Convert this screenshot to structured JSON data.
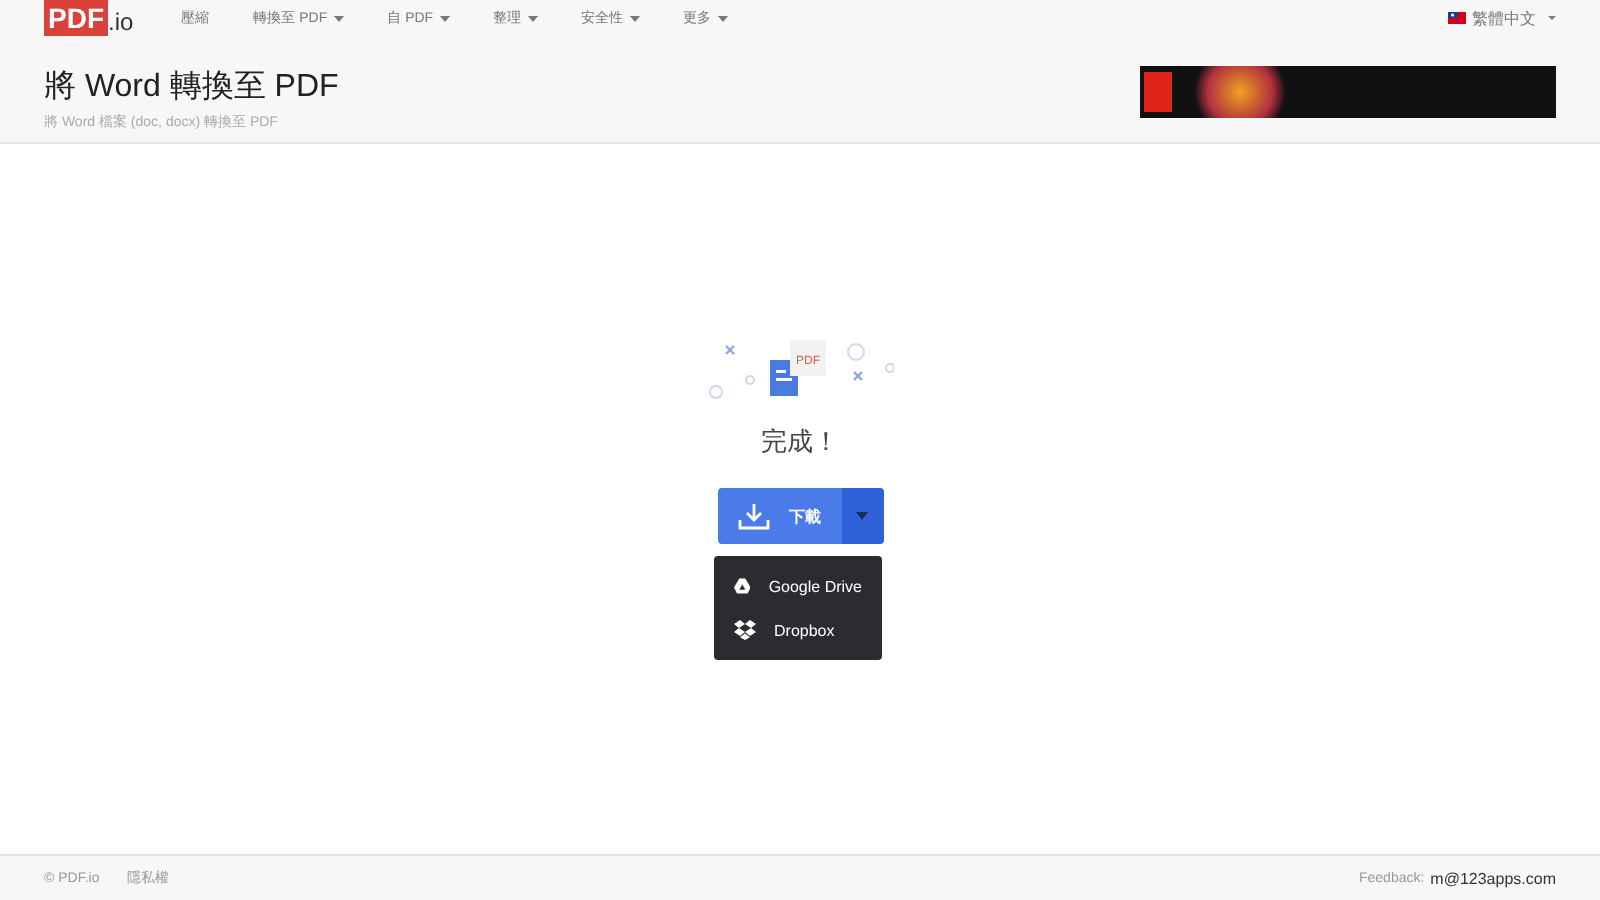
{
  "nav": {
    "logo": {
      "main": "PDF",
      "suffix": ".io"
    },
    "items": [
      {
        "label": "壓縮",
        "dropdown": false
      },
      {
        "label": "轉換至 PDF",
        "dropdown": true
      },
      {
        "label": "自 PDF",
        "dropdown": true
      },
      {
        "label": "整理",
        "dropdown": true
      },
      {
        "label": "安全性",
        "dropdown": true
      },
      {
        "label": "更多",
        "dropdown": true
      }
    ],
    "language": "繁體中文"
  },
  "header": {
    "title": "將 Word 轉換至 PDF",
    "subtitle": "將 Word 檔案 (doc, docx) 轉換至 PDF"
  },
  "result": {
    "illustration_label": "PDF",
    "status": "完成！",
    "download_button": "下載",
    "menu_open": true,
    "menu_items": [
      {
        "kind": "drive",
        "label": "Google Drive"
      },
      {
        "kind": "dropbox",
        "label": "Dropbox"
      }
    ]
  },
  "footer": {
    "copyright": "© PDF.io",
    "privacy": "隱私權",
    "feedback_label": "Feedback:",
    "feedback_email": "m@123apps.com"
  }
}
